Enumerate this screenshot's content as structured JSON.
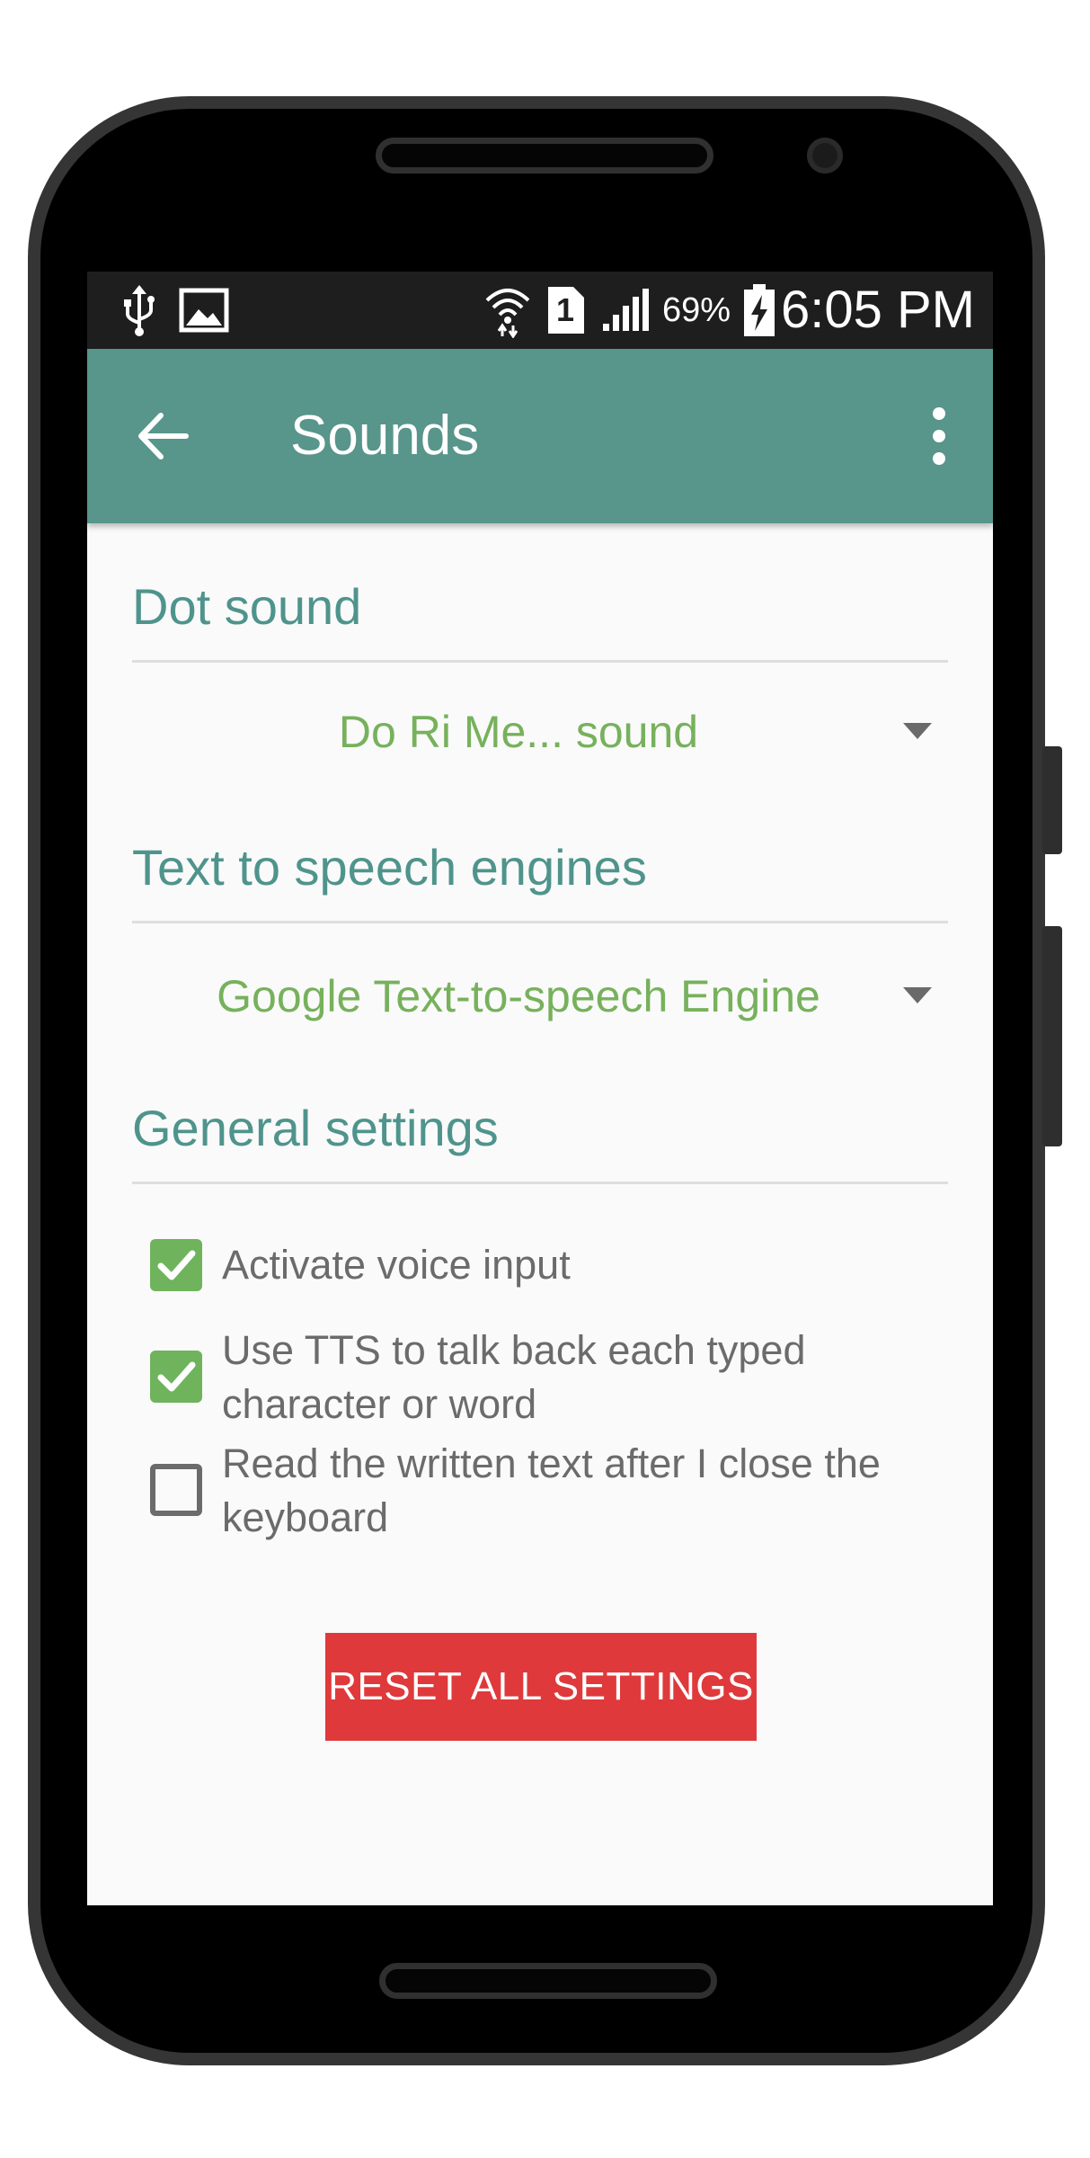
{
  "status_bar": {
    "time": "6:05 PM",
    "battery_percent": "69%",
    "sim_slot": "1",
    "icons": [
      "usb-icon",
      "image-icon",
      "wifi-icon",
      "sim-icon",
      "signal-icon",
      "battery-charging-icon"
    ]
  },
  "app_bar": {
    "title": "Sounds",
    "back_icon": "arrow-left-icon",
    "menu_icon": "more-vert-icon",
    "color": "#58958a"
  },
  "sections": {
    "dot_sound": {
      "title": "Dot sound",
      "selected": "Do Ri Me... sound"
    },
    "tts_engines": {
      "title": "Text to speech engines",
      "selected": "Google Text-to-speech Engine"
    },
    "general": {
      "title": "General settings",
      "options": [
        {
          "label": "Activate voice input",
          "checked": true
        },
        {
          "label": "Use TTS to talk back each typed character or word",
          "checked": true
        },
        {
          "label": "Read the written text after I close the keyboard",
          "checked": false
        }
      ]
    }
  },
  "reset_button": {
    "label": "RESET ALL SETTINGS",
    "color": "#e0393b"
  },
  "colors": {
    "section_title": "#4f948c",
    "dropdown_value": "#77b15c",
    "checkbox_checked": "#6fb35c"
  }
}
